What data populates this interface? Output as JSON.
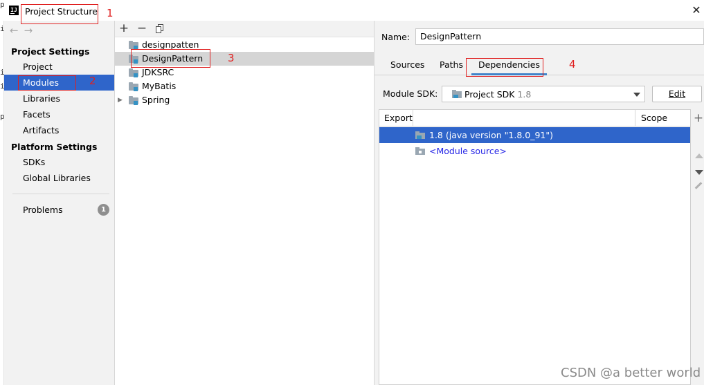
{
  "window": {
    "app_icon_text": "IJ",
    "title": "Project Structure",
    "close_icon": "close-icon"
  },
  "sidebar": {
    "nav_back": "←",
    "nav_forward": "→",
    "sections": [
      {
        "heading": "Project Settings",
        "items": [
          "Project",
          "Modules",
          "Libraries",
          "Facets",
          "Artifacts"
        ]
      },
      {
        "heading": "Platform Settings",
        "items": [
          "SDKs",
          "Global Libraries"
        ]
      }
    ],
    "selected_item": "Modules",
    "problems": {
      "label": "Problems",
      "count": "1"
    }
  },
  "modules_panel": {
    "toolbar": {
      "add": "+",
      "remove": "−",
      "copy_icon": "copy-icon"
    },
    "tree": [
      {
        "label": "designpatten",
        "expandable": false,
        "selected": false
      },
      {
        "label": "DesignPattern",
        "expandable": false,
        "selected": true
      },
      {
        "label": "JDKSRC",
        "expandable": false,
        "selected": false
      },
      {
        "label": "MyBatis",
        "expandable": false,
        "selected": false
      },
      {
        "label": "Spring",
        "expandable": true,
        "selected": false
      }
    ]
  },
  "detail": {
    "name_label": "Name:",
    "name_value": "DesignPattern",
    "tabs": [
      "Sources",
      "Paths",
      "Dependencies"
    ],
    "active_tab": "Dependencies",
    "sdk_label": "Module SDK:",
    "sdk_value": "Project SDK",
    "sdk_version": "1.8",
    "edit_button": "Edit",
    "table": {
      "columns": [
        "Export",
        "Scope"
      ],
      "rows": [
        {
          "text": "1.8 (java version \"1.8.0_91\")",
          "selected": true
        },
        {
          "text": "<Module source>",
          "selected": false
        }
      ]
    },
    "side_tools": {
      "add": "+"
    }
  },
  "annotations": [
    "1",
    "2",
    "3",
    "4"
  ],
  "watermark": "CSDN @a better world",
  "colors": {
    "selection": "#2f65ca",
    "annotation": "#e02020",
    "tab_underline": "#4083c9",
    "module_source": "#2424e6"
  },
  "edge_code_chars": [
    "p",
    "i",
    "i",
    "i",
    "p"
  ]
}
